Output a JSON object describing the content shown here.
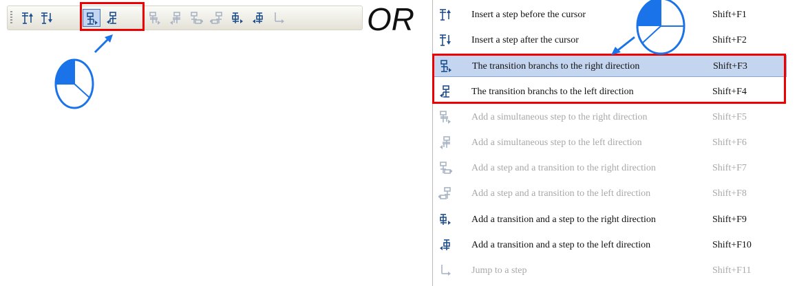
{
  "toolbar": {
    "buttons": [
      {
        "icon": "insert-step-before-icon",
        "enabled": true,
        "selected": false
      },
      {
        "icon": "insert-step-after-icon",
        "enabled": true,
        "selected": false
      },
      {
        "icon": "transition-branch-right-icon",
        "enabled": true,
        "selected": true
      },
      {
        "icon": "transition-branch-left-icon",
        "enabled": true,
        "selected": false
      },
      {
        "icon": "simultaneous-step-right-icon",
        "enabled": false,
        "selected": false
      },
      {
        "icon": "simultaneous-step-left-icon",
        "enabled": false,
        "selected": false
      },
      {
        "icon": "step-transition-right-icon",
        "enabled": false,
        "selected": false
      },
      {
        "icon": "step-transition-left-icon",
        "enabled": false,
        "selected": false
      },
      {
        "icon": "transition-step-right-icon",
        "enabled": true,
        "selected": false
      },
      {
        "icon": "transition-step-left-icon",
        "enabled": true,
        "selected": false
      },
      {
        "icon": "jump-to-step-icon",
        "enabled": false,
        "selected": false
      }
    ]
  },
  "or_label": "OR",
  "menu": {
    "items": [
      {
        "label": "Insert a step before the cursor",
        "shortcut": "Shift+F1",
        "enabled": true,
        "highlighted": false,
        "icon": "insert-step-before-icon"
      },
      {
        "label": "Insert a step after the cursor",
        "shortcut": "Shift+F2",
        "enabled": true,
        "highlighted": false,
        "icon": "insert-step-after-icon"
      },
      {
        "label": "The transition branchs to the right direction",
        "shortcut": "Shift+F3",
        "enabled": true,
        "highlighted": true,
        "icon": "transition-branch-right-icon"
      },
      {
        "label": "The transition branchs to the left direction",
        "shortcut": "Shift+F4",
        "enabled": true,
        "highlighted": false,
        "icon": "transition-branch-left-icon"
      },
      {
        "label": "Add a simultaneous step to the right direction",
        "shortcut": "Shift+F5",
        "enabled": false,
        "highlighted": false,
        "icon": "simultaneous-step-right-icon"
      },
      {
        "label": "Add a simultaneous step to the left direction",
        "shortcut": "Shift+F6",
        "enabled": false,
        "highlighted": false,
        "icon": "simultaneous-step-left-icon"
      },
      {
        "label": "Add a step and a transition to the right direction",
        "shortcut": "Shift+F7",
        "enabled": false,
        "highlighted": false,
        "icon": "step-transition-right-icon"
      },
      {
        "label": "Add a step and a transition to the left direction",
        "shortcut": "Shift+F8",
        "enabled": false,
        "highlighted": false,
        "icon": "step-transition-left-icon"
      },
      {
        "label": "Add a transition and a step to the right direction",
        "shortcut": "Shift+F9",
        "enabled": true,
        "highlighted": false,
        "icon": "transition-step-right-icon"
      },
      {
        "label": "Add a transition and a step to the left direction",
        "shortcut": "Shift+F10",
        "enabled": true,
        "highlighted": false,
        "icon": "transition-step-left-icon"
      },
      {
        "label": "Jump to a step",
        "shortcut": "Shift+F11",
        "enabled": false,
        "highlighted": false,
        "icon": "jump-to-step-icon"
      }
    ]
  },
  "colors": {
    "highlight_box": "#ee0000",
    "selection": "#c4d5ef",
    "icon_enabled": "#1f4f8f",
    "icon_disabled": "#a9b4c4",
    "pointer_blue": "#1a73e8"
  }
}
